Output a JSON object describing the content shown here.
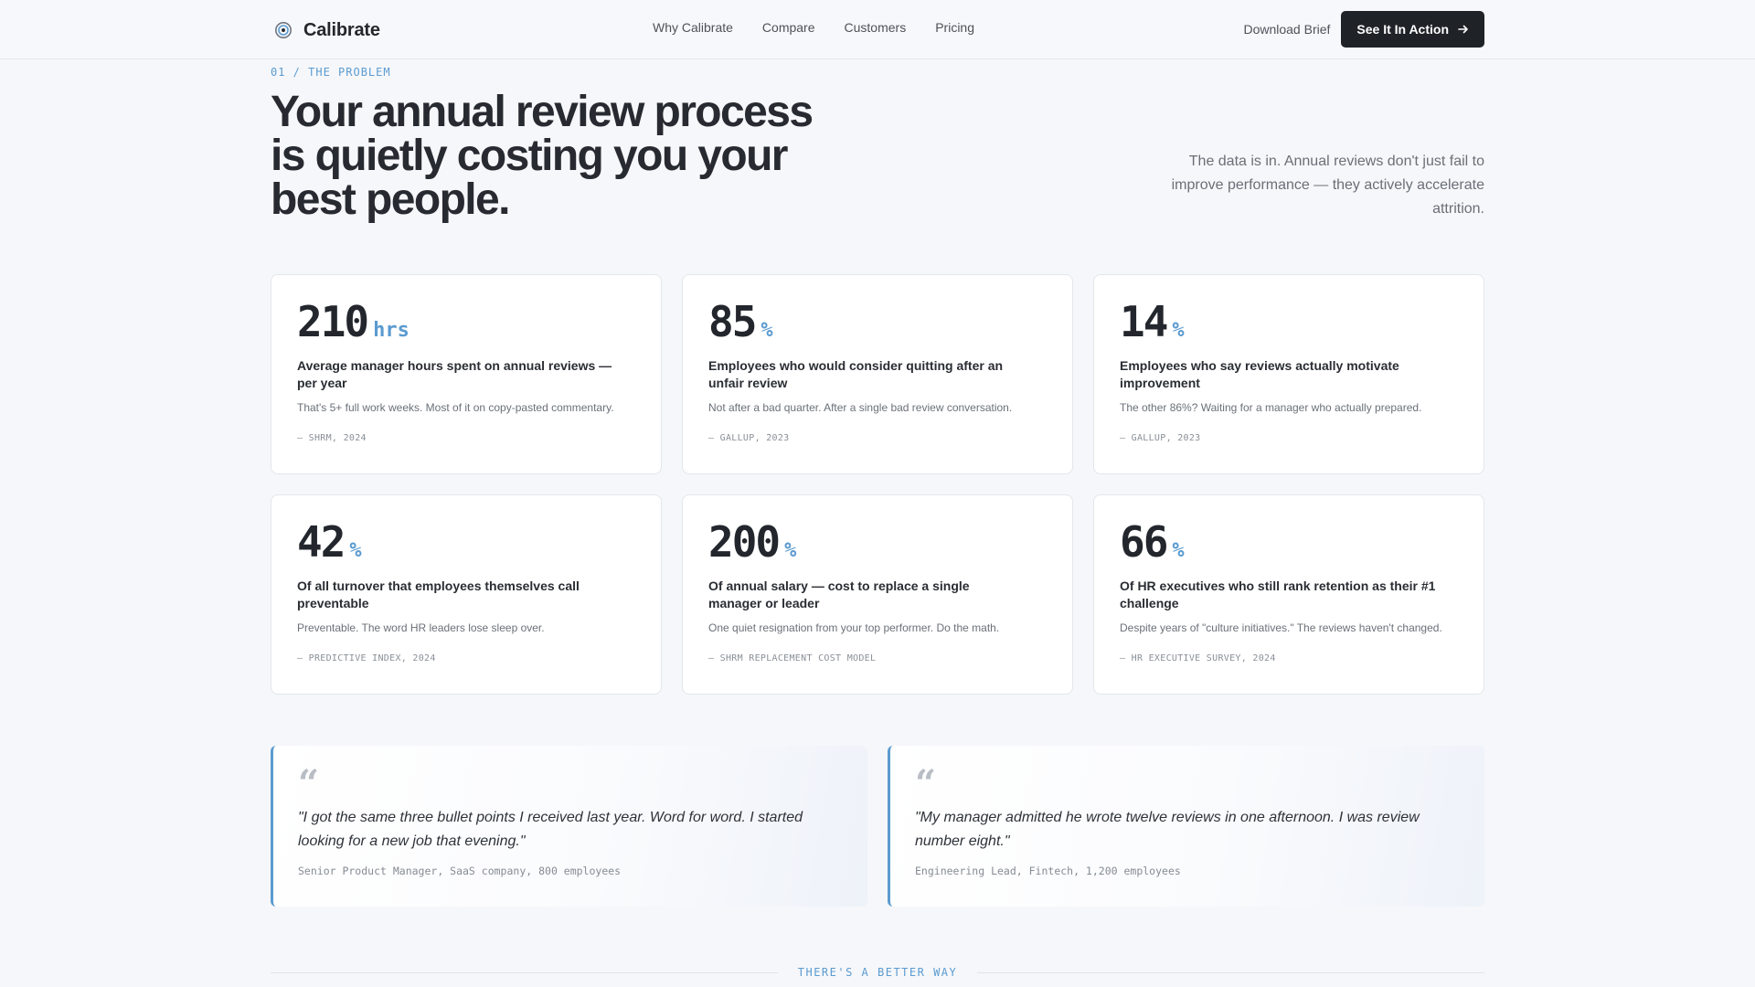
{
  "header": {
    "brand": "Calibrate",
    "nav": [
      "Why Calibrate",
      "Compare",
      "Customers",
      "Pricing"
    ],
    "download_label": "Download Brief",
    "cta_label": "See It In Action"
  },
  "hero": {
    "eyebrow": "01 / THE PROBLEM",
    "headline": "Your annual review process is quietly costing you your best people.",
    "lede": "The data is in. Annual reviews don't just fail to improve performance — they actively accelerate attrition."
  },
  "stats": [
    {
      "value": "210",
      "unit": "hrs",
      "title": "Average manager hours spent on annual reviews — per year",
      "desc": "That's 5+ full work weeks. Most of it on copy-pasted commentary.",
      "source": "— SHRM, 2024"
    },
    {
      "value": "85",
      "unit": "%",
      "title": "Employees who would consider quitting after an unfair review",
      "desc": "Not after a bad quarter. After a single bad review conversation.",
      "source": "— GALLUP, 2023"
    },
    {
      "value": "14",
      "unit": "%",
      "title": "Employees who say reviews actually motivate improvement",
      "desc": "The other 86%? Waiting for a manager who actually prepared.",
      "source": "— GALLUP, 2023"
    },
    {
      "value": "42",
      "unit": "%",
      "title": "Of all turnover that employees themselves call preventable",
      "desc": "Preventable. The word HR leaders lose sleep over.",
      "source": "— PREDICTIVE INDEX, 2024"
    },
    {
      "value": "200",
      "unit": "%",
      "title": "Of annual salary — cost to replace a single manager or leader",
      "desc": "One quiet resignation from your top performer. Do the math.",
      "source": "— SHRM REPLACEMENT COST MODEL"
    },
    {
      "value": "66",
      "unit": "%",
      "title": "Of HR executives who still rank retention as their #1 challenge",
      "desc": "Despite years of \"culture initiatives.\" The reviews haven't changed.",
      "source": "— HR EXECUTIVE SURVEY, 2024"
    }
  ],
  "quotes": [
    {
      "mark": "“",
      "text": "\"I got the same three bullet points I received last year. Word for word. I started looking for a new job that evening.\"",
      "attribution": "Senior Product Manager, SaaS company, 800 employees"
    },
    {
      "mark": "“",
      "text": "\"My manager admitted he wrote twelve reviews in one afternoon. I was review number eight.\"",
      "attribution": "Engineering Lead, Fintech, 1,200 employees"
    }
  ],
  "divider": {
    "label": "THERE'S A BETTER WAY"
  },
  "colors": {
    "accent": "#5b9bd0",
    "dark": "#1f2328",
    "background": "#f6f7fa"
  }
}
